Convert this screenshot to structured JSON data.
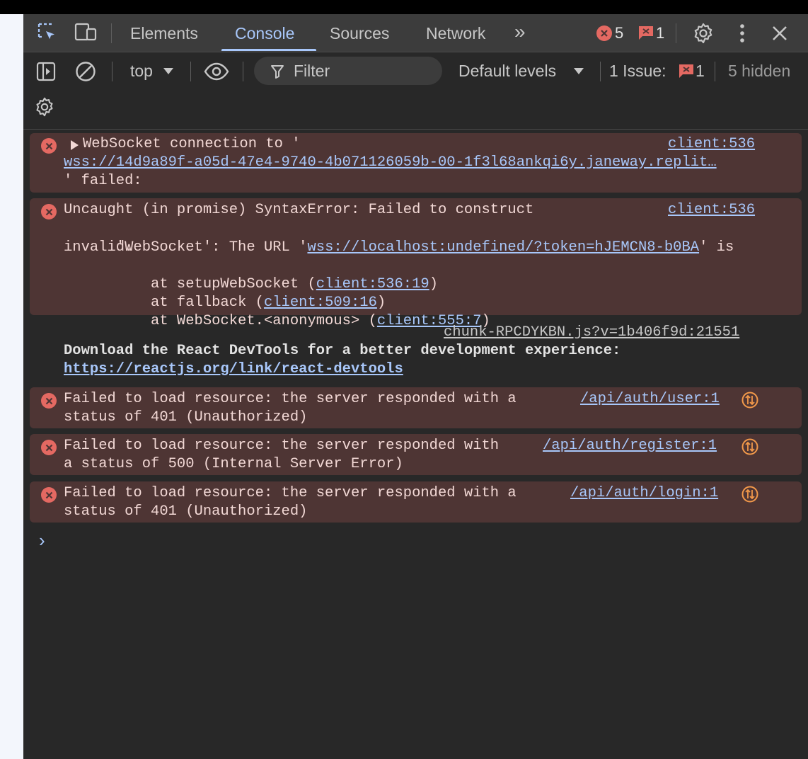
{
  "tabs": [
    {
      "label": "Elements"
    },
    {
      "label": "Console"
    },
    {
      "label": "Sources"
    },
    {
      "label": "Network"
    }
  ],
  "more_tabs_glyph": "»",
  "counts": {
    "errors": "5",
    "issues": "1"
  },
  "toolbar2": {
    "context": "top",
    "filter_placeholder": "Filter",
    "levels": "Default levels",
    "issues_label": "1 Issue:",
    "issues_count": "1",
    "hidden": "5 hidden"
  },
  "messages": {
    "m1": {
      "line1": "WebSocket connection to '",
      "url": "wss://14d9a89f-a05d-47e4-9740-4b071126059b-00-1f3l68ankqi6y.janeway.replit…",
      "line3": "' failed:",
      "source": "client:536"
    },
    "m2": {
      "line1": "Uncaught (in promise) SyntaxError: Failed to construct",
      "line2_pre": "'WebSocket': The URL '",
      "line2_link": "wss://localhost:undefined/?token=hJEMCN8-b0BA",
      "line2_post": "' is",
      "line3": "invalid.",
      "st1_pre": "    at setupWebSocket (",
      "st1_link": "client:536:19",
      "st2_pre": "    at fallback (",
      "st2_link": "client:509:16",
      "st3_pre": "    at WebSocket.<anonymous> (",
      "st3_link": "client:555:7",
      "close": ")",
      "source": "client:536"
    },
    "m3": {
      "source": "chunk-RPCDYKBN.js?v=1b406f9d:21551",
      "line1": "Download the React DevTools for a better development experience:",
      "link": "https://reactjs.org/link/react-devtools"
    },
    "m4": {
      "line1": "Failed to load resource: the server responded with a",
      "line2": "status of 401 (Unauthorized)",
      "source": "/api/auth/user:1"
    },
    "m5": {
      "line1": "Failed to load resource: the server responded with",
      "line2": "a status of 500 (Internal Server Error)",
      "source": "/api/auth/register:1"
    },
    "m6": {
      "line1": "Failed to load resource: the server responded with a",
      "line2": "status of 401 (Unauthorized)",
      "source": "/api/auth/login:1"
    }
  },
  "prompt_glyph": "›",
  "colors": {
    "error_bg": "#4e3534",
    "error_icon": "#e46962",
    "link": "#a8c7fa",
    "accent": "#a8c7fa",
    "panel": "#282828"
  }
}
